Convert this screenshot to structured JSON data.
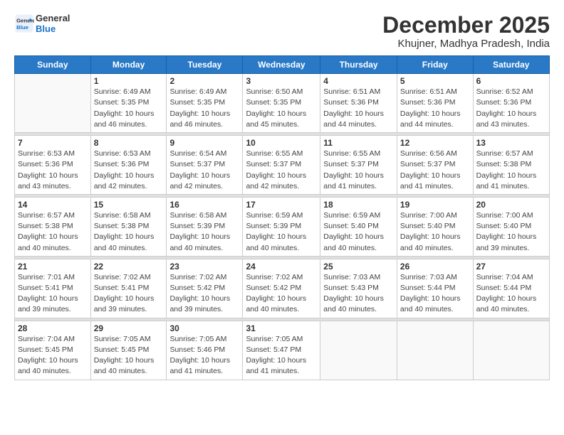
{
  "logo": {
    "line1": "General",
    "line2": "Blue"
  },
  "title": "December 2025",
  "subtitle": "Khujner, Madhya Pradesh, India",
  "days_of_week": [
    "Sunday",
    "Monday",
    "Tuesday",
    "Wednesday",
    "Thursday",
    "Friday",
    "Saturday"
  ],
  "weeks": [
    [
      {
        "num": "",
        "info": ""
      },
      {
        "num": "1",
        "info": "Sunrise: 6:49 AM\nSunset: 5:35 PM\nDaylight: 10 hours\nand 46 minutes."
      },
      {
        "num": "2",
        "info": "Sunrise: 6:49 AM\nSunset: 5:35 PM\nDaylight: 10 hours\nand 46 minutes."
      },
      {
        "num": "3",
        "info": "Sunrise: 6:50 AM\nSunset: 5:35 PM\nDaylight: 10 hours\nand 45 minutes."
      },
      {
        "num": "4",
        "info": "Sunrise: 6:51 AM\nSunset: 5:36 PM\nDaylight: 10 hours\nand 44 minutes."
      },
      {
        "num": "5",
        "info": "Sunrise: 6:51 AM\nSunset: 5:36 PM\nDaylight: 10 hours\nand 44 minutes."
      },
      {
        "num": "6",
        "info": "Sunrise: 6:52 AM\nSunset: 5:36 PM\nDaylight: 10 hours\nand 43 minutes."
      }
    ],
    [
      {
        "num": "7",
        "info": "Sunrise: 6:53 AM\nSunset: 5:36 PM\nDaylight: 10 hours\nand 43 minutes."
      },
      {
        "num": "8",
        "info": "Sunrise: 6:53 AM\nSunset: 5:36 PM\nDaylight: 10 hours\nand 42 minutes."
      },
      {
        "num": "9",
        "info": "Sunrise: 6:54 AM\nSunset: 5:37 PM\nDaylight: 10 hours\nand 42 minutes."
      },
      {
        "num": "10",
        "info": "Sunrise: 6:55 AM\nSunset: 5:37 PM\nDaylight: 10 hours\nand 42 minutes."
      },
      {
        "num": "11",
        "info": "Sunrise: 6:55 AM\nSunset: 5:37 PM\nDaylight: 10 hours\nand 41 minutes."
      },
      {
        "num": "12",
        "info": "Sunrise: 6:56 AM\nSunset: 5:37 PM\nDaylight: 10 hours\nand 41 minutes."
      },
      {
        "num": "13",
        "info": "Sunrise: 6:57 AM\nSunset: 5:38 PM\nDaylight: 10 hours\nand 41 minutes."
      }
    ],
    [
      {
        "num": "14",
        "info": "Sunrise: 6:57 AM\nSunset: 5:38 PM\nDaylight: 10 hours\nand 40 minutes."
      },
      {
        "num": "15",
        "info": "Sunrise: 6:58 AM\nSunset: 5:38 PM\nDaylight: 10 hours\nand 40 minutes."
      },
      {
        "num": "16",
        "info": "Sunrise: 6:58 AM\nSunset: 5:39 PM\nDaylight: 10 hours\nand 40 minutes."
      },
      {
        "num": "17",
        "info": "Sunrise: 6:59 AM\nSunset: 5:39 PM\nDaylight: 10 hours\nand 40 minutes."
      },
      {
        "num": "18",
        "info": "Sunrise: 6:59 AM\nSunset: 5:40 PM\nDaylight: 10 hours\nand 40 minutes."
      },
      {
        "num": "19",
        "info": "Sunrise: 7:00 AM\nSunset: 5:40 PM\nDaylight: 10 hours\nand 40 minutes."
      },
      {
        "num": "20",
        "info": "Sunrise: 7:00 AM\nSunset: 5:40 PM\nDaylight: 10 hours\nand 39 minutes."
      }
    ],
    [
      {
        "num": "21",
        "info": "Sunrise: 7:01 AM\nSunset: 5:41 PM\nDaylight: 10 hours\nand 39 minutes."
      },
      {
        "num": "22",
        "info": "Sunrise: 7:02 AM\nSunset: 5:41 PM\nDaylight: 10 hours\nand 39 minutes."
      },
      {
        "num": "23",
        "info": "Sunrise: 7:02 AM\nSunset: 5:42 PM\nDaylight: 10 hours\nand 39 minutes."
      },
      {
        "num": "24",
        "info": "Sunrise: 7:02 AM\nSunset: 5:42 PM\nDaylight: 10 hours\nand 40 minutes."
      },
      {
        "num": "25",
        "info": "Sunrise: 7:03 AM\nSunset: 5:43 PM\nDaylight: 10 hours\nand 40 minutes."
      },
      {
        "num": "26",
        "info": "Sunrise: 7:03 AM\nSunset: 5:44 PM\nDaylight: 10 hours\nand 40 minutes."
      },
      {
        "num": "27",
        "info": "Sunrise: 7:04 AM\nSunset: 5:44 PM\nDaylight: 10 hours\nand 40 minutes."
      }
    ],
    [
      {
        "num": "28",
        "info": "Sunrise: 7:04 AM\nSunset: 5:45 PM\nDaylight: 10 hours\nand 40 minutes."
      },
      {
        "num": "29",
        "info": "Sunrise: 7:05 AM\nSunset: 5:45 PM\nDaylight: 10 hours\nand 40 minutes."
      },
      {
        "num": "30",
        "info": "Sunrise: 7:05 AM\nSunset: 5:46 PM\nDaylight: 10 hours\nand 41 minutes."
      },
      {
        "num": "31",
        "info": "Sunrise: 7:05 AM\nSunset: 5:47 PM\nDaylight: 10 hours\nand 41 minutes."
      },
      {
        "num": "",
        "info": ""
      },
      {
        "num": "",
        "info": ""
      },
      {
        "num": "",
        "info": ""
      }
    ]
  ]
}
